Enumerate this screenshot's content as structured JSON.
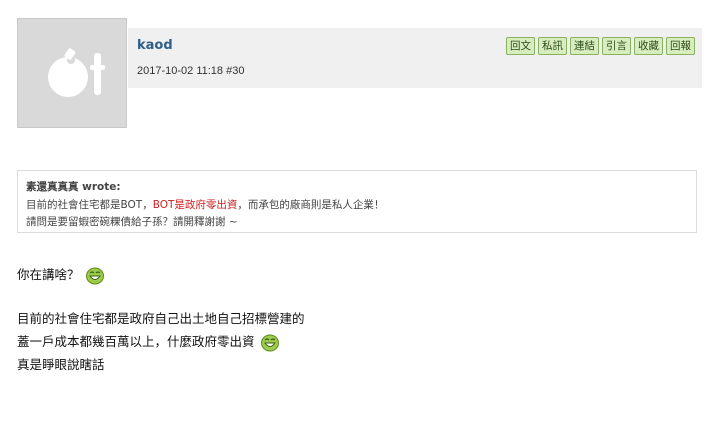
{
  "post": {
    "username": "kaod",
    "timestamp": "2017-10-02 11:18",
    "post_number": "#30",
    "actions": [
      "回文",
      "私訊",
      "連結",
      "引言",
      "收藏",
      "回報"
    ]
  },
  "quote": {
    "author": "素還真真真 wrote:",
    "line1_a": "目前的社會住宅都是BOT，",
    "line1_red": "BOT是政府零出資",
    "line1_b": "，而承包的廠商則是私人企業！",
    "line2": "請問是要留蝦密碗粿債給子孫？請開釋謝謝 ~"
  },
  "body": {
    "line1": "你在講啥？",
    "line2": "目前的社會住宅都是政府自己出土地自己招標營建的",
    "line3": "蓋一戶成本都幾百萬以上，什麼政府零出資",
    "line4": "真是睜眼說瞎話"
  },
  "colors": {
    "header_bg": "#f0f0f0",
    "button_bg": "#d7ecbf",
    "button_border": "#88b25c",
    "quote_highlight": "#cc1f1f"
  },
  "icons": {
    "avatar": "default-avatar-icon",
    "smiley": "green-laughing-smiley-icon"
  }
}
